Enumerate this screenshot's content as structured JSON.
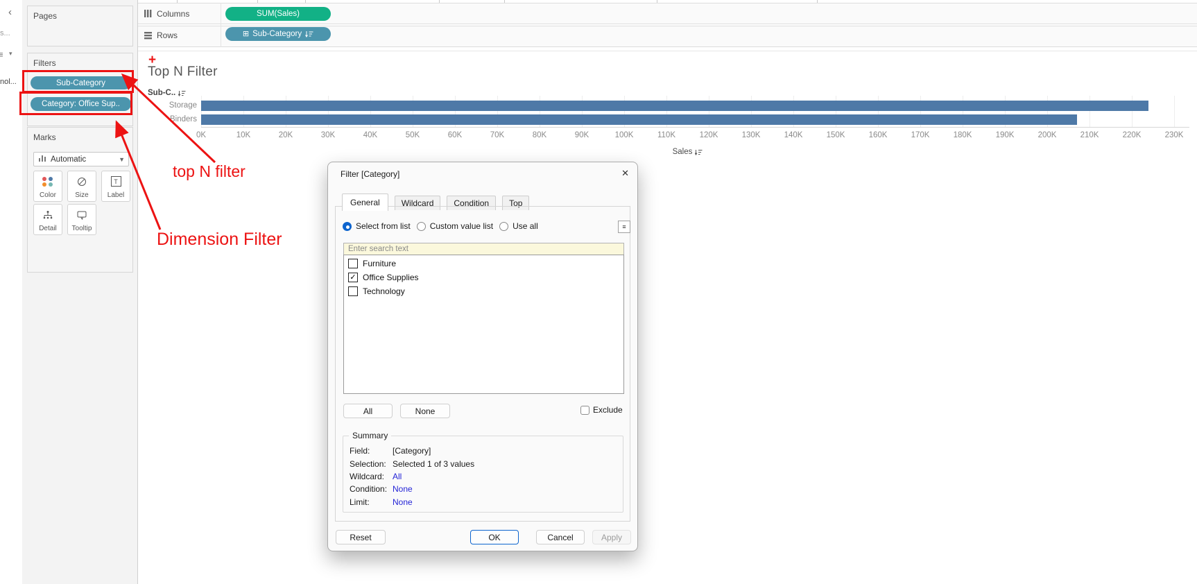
{
  "colors": {
    "pill_green": "#12b186",
    "pill_blue": "#4c95ad",
    "bar_blue": "#4e79a7",
    "annotation_red": "#ec1313",
    "link_blue": "#2323d6",
    "accent_blue": "#0c64ce",
    "search_bg": "#fbf8dc",
    "mark_dots": [
      "#e15759",
      "#4e79a7",
      "#f28e2b",
      "#76b7b2"
    ]
  },
  "left_strip": {
    "chevron": "‹",
    "fragment1": "s...",
    "list_icon": "≡",
    "caret": "▾",
    "fragment2": "nol..."
  },
  "sidebar": {
    "pages_label": "Pages",
    "filters_label": "Filters",
    "filter_pills": [
      {
        "label": "Sub-Category"
      },
      {
        "label": "Category: Office Sup.."
      }
    ],
    "marks_label": "Marks",
    "mark_type": "Automatic",
    "mark_buttons": [
      {
        "label": "Color"
      },
      {
        "label": "Size"
      },
      {
        "label": "Label"
      },
      {
        "label": "Detail"
      },
      {
        "label": "Tooltip"
      }
    ]
  },
  "shelves": {
    "columns_label": "Columns",
    "columns_pill": "SUM(Sales)",
    "rows_label": "Rows",
    "rows_pill_expand": "⊞",
    "rows_pill": "Sub-Category"
  },
  "sheet": {
    "title": "Top N Filter"
  },
  "chart_data": {
    "type": "bar",
    "orientation": "horizontal",
    "title": "Top N Filter",
    "row_header": "Sub-C..",
    "categories": [
      "Storage",
      "Binders"
    ],
    "series_name": "SUM(Sales)",
    "values": [
      224000,
      207000
    ],
    "xlabel": "Sales",
    "xlim": [
      0,
      230000
    ],
    "x_ticks": [
      "0K",
      "10K",
      "20K",
      "30K",
      "40K",
      "50K",
      "60K",
      "70K",
      "80K",
      "90K",
      "100K",
      "110K",
      "120K",
      "130K",
      "140K",
      "150K",
      "160K",
      "170K",
      "180K",
      "190K",
      "200K",
      "210K",
      "220K",
      "230K"
    ],
    "grid": true,
    "legend": "none"
  },
  "annotations": {
    "plus": "+",
    "top_n_label": "top N filter",
    "dimension_label": "Dimension Filter"
  },
  "dialog": {
    "title": "Filter [Category]",
    "close": "✕",
    "tabs": [
      {
        "label": "General",
        "active": true
      },
      {
        "label": "Wildcard",
        "active": false
      },
      {
        "label": "Condition",
        "active": false
      },
      {
        "label": "Top",
        "active": false
      }
    ],
    "radios": [
      {
        "label": "Select from list",
        "selected": true
      },
      {
        "label": "Custom value list",
        "selected": false
      },
      {
        "label": "Use all",
        "selected": false
      }
    ],
    "search_placeholder": "Enter search text",
    "items": [
      {
        "label": "Furniture",
        "checked": false
      },
      {
        "label": "Office Supplies",
        "checked": true
      },
      {
        "label": "Technology",
        "checked": false
      }
    ],
    "all_button": "All",
    "none_button": "None",
    "exclude_label": "Exclude",
    "summary": {
      "heading": "Summary",
      "rows": [
        {
          "label": "Field:",
          "value": "[Category]",
          "link": false
        },
        {
          "label": "Selection:",
          "value": "Selected 1 of 3 values",
          "link": false
        },
        {
          "label": "Wildcard:",
          "value": "All",
          "link": true
        },
        {
          "label": "Condition:",
          "value": "None",
          "link": true
        },
        {
          "label": "Limit:",
          "value": "None",
          "link": true
        }
      ]
    },
    "reset_button": "Reset",
    "ok_button": "OK",
    "cancel_button": "Cancel",
    "apply_button": "Apply"
  }
}
